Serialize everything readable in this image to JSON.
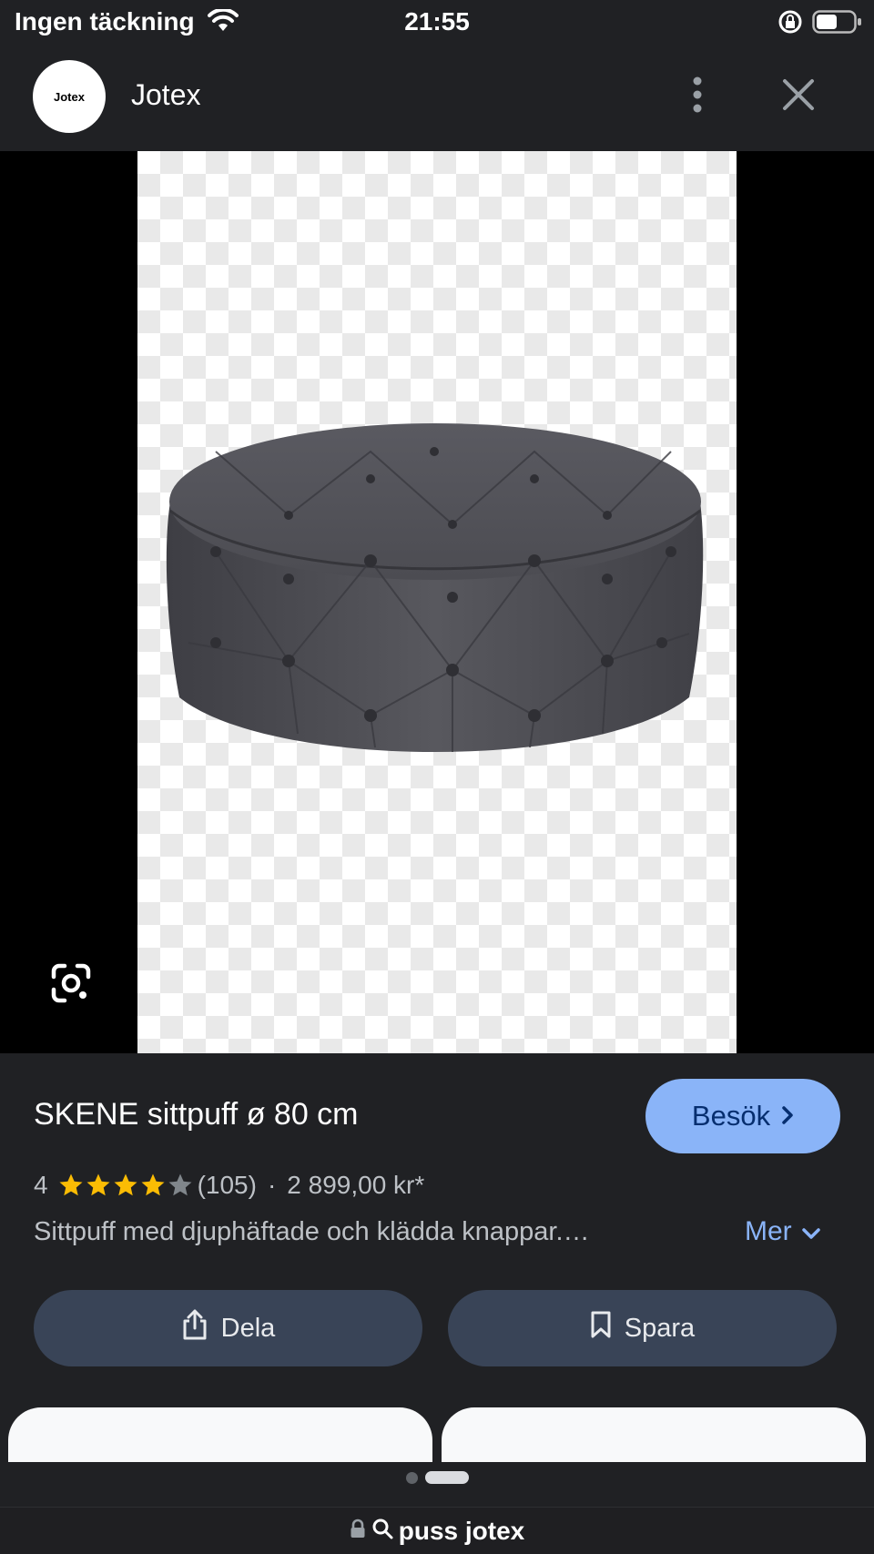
{
  "status_bar": {
    "carrier": "Ingen täckning",
    "time": "21:55",
    "icons": [
      "wifi-icon",
      "rotation-lock-icon",
      "battery-icon"
    ]
  },
  "header": {
    "logo_text": "Jotex",
    "site_name": "Jotex",
    "icons": [
      "more-vert-icon",
      "close-icon"
    ]
  },
  "image": {
    "lens_icon": "google-lens-icon"
  },
  "product": {
    "title": "SKENE sittpuff ø 80 cm",
    "visit_label": "Besök",
    "rating_value": "4",
    "rating_stars": 4,
    "rating_max": 5,
    "review_count": "(105)",
    "separator": "·",
    "price": "2 899,00 kr*",
    "description": "Sittpuff med djuphäftade och klädda knappar.…",
    "more_label": "Mer"
  },
  "actions": {
    "share_label": "Dela",
    "save_label": "Spara"
  },
  "pager": {
    "count": 2,
    "active_index": 1
  },
  "url_bar": {
    "text": "puss jotex"
  },
  "colors": {
    "background": "#202124",
    "accent_button": "#8ab4f8",
    "pill_button": "#394457",
    "link": "#8ab4f8",
    "star": "#fbbc04"
  }
}
